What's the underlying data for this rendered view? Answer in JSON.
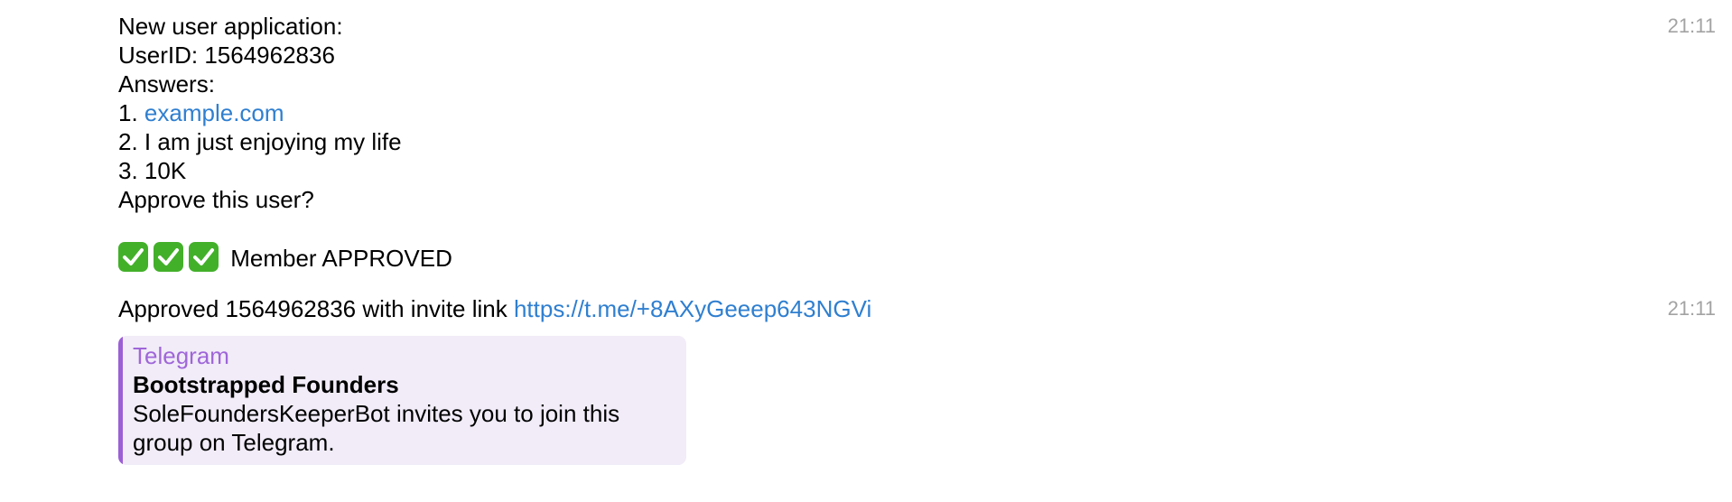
{
  "message1": {
    "lines": [
      "New user application:",
      "UserID: 1564962836",
      "Answers:"
    ],
    "answer1_prefix": "1. ",
    "answer1_link": "example.com",
    "answer2": "2. I am just enjoying my life",
    "answer3": "3. 10K",
    "question": "Approve this user?",
    "status_icon": "check-mark-button-emoji",
    "status_text": "Member APPROVED",
    "time": "21:11"
  },
  "message2": {
    "text": "Approved 1564962836 with invite link ",
    "link": "https://t.me/+8AXyGeeep643NGVi",
    "time": "21:11",
    "preview": {
      "site": "Telegram",
      "title": "Bootstrapped Founders",
      "description": "SoleFoundersKeeperBot invites you to join this group on Telegram.",
      "accent_color": "#9b5fd6",
      "background_color": "#f1ecf8"
    }
  },
  "colors": {
    "link": "#2f7fd0",
    "timestamp": "#a3a3a3",
    "check_green": "#43b02a"
  }
}
